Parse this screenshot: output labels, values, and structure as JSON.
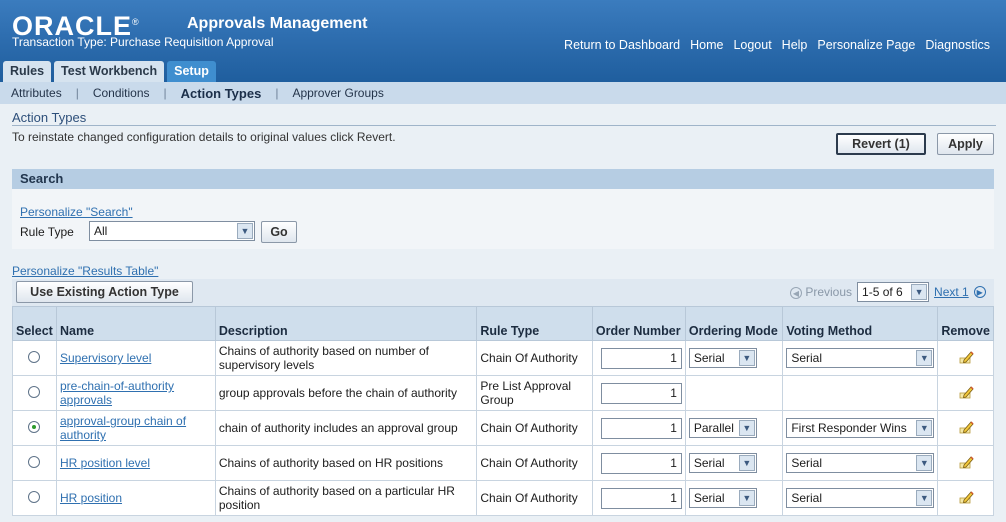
{
  "header": {
    "logo_text": "ORACLE",
    "registered_mark": "®",
    "app_title": "Approvals Management",
    "transaction_type": "Transaction Type: Purchase Requisition Approval",
    "links": [
      "Return to Dashboard",
      "Home",
      "Logout",
      "Help",
      "Personalize Page",
      "Diagnostics"
    ]
  },
  "tabs": [
    {
      "label": "Rules",
      "active": false
    },
    {
      "label": "Test Workbench",
      "active": false
    },
    {
      "label": "Setup",
      "active": true
    }
  ],
  "subnav": {
    "items": [
      "Attributes",
      "Conditions",
      "Action Types",
      "Approver Groups"
    ],
    "active": "Action Types"
  },
  "page": {
    "title": "Action Types",
    "instruction": "To reinstate changed configuration details to original values click Revert.",
    "revert_label": "Revert (1)",
    "apply_label": "Apply"
  },
  "search": {
    "header": "Search",
    "personalize_link": "Personalize \"Search\"",
    "rule_type_label": "Rule Type",
    "rule_type_value": "All",
    "go_label": "Go"
  },
  "results": {
    "personalize_link": "Personalize \"Results Table\"",
    "use_existing_label": "Use Existing Action Type",
    "pager": {
      "previous": "Previous",
      "range": "1-5 of 6",
      "next": "Next 1"
    },
    "columns": {
      "select": "Select",
      "name": "Name",
      "description": "Description",
      "rule_type": "Rule Type",
      "order_number": "Order Number",
      "ordering_mode": "Ordering Mode",
      "voting_method": "Voting Method",
      "remove": "Remove"
    },
    "rows": [
      {
        "name": "Supervisory level",
        "description": "Chains of authority based on number of supervisory levels",
        "rule_type": "Chain Of Authority",
        "order_number": "1",
        "ordering_mode": "Serial",
        "voting_method": "Serial",
        "selected": false
      },
      {
        "name": "pre-chain-of-authority approvals",
        "description": "group approvals before the chain of authority",
        "rule_type": "Pre List Approval Group",
        "order_number": "1",
        "ordering_mode": "",
        "voting_method": "",
        "selected": false
      },
      {
        "name": "approval-group chain of authority",
        "description": "chain of authority includes an approval group",
        "rule_type": "Chain Of Authority",
        "order_number": "1",
        "ordering_mode": "Parallel",
        "voting_method": "First Responder Wins",
        "selected": true
      },
      {
        "name": "HR position level",
        "description": "Chains of authority based on HR positions",
        "rule_type": "Chain Of Authority",
        "order_number": "1",
        "ordering_mode": "Serial",
        "voting_method": "Serial",
        "selected": false
      },
      {
        "name": "HR position",
        "description": "Chains of authority based on a particular HR position",
        "rule_type": "Chain Of Authority",
        "order_number": "1",
        "ordering_mode": "Serial",
        "voting_method": "Serial",
        "selected": false
      }
    ]
  },
  "icons": {
    "dropdown": "chevron-down-icon",
    "previous": "previous-circle-icon",
    "next": "next-circle-icon",
    "remove": "pencil-edit-icon"
  },
  "colors": {
    "header_blue": "#2f6fb1",
    "active_tab": "#3f8ecf",
    "link": "#2f70b0",
    "selected_radio": "#2c9a2c"
  }
}
